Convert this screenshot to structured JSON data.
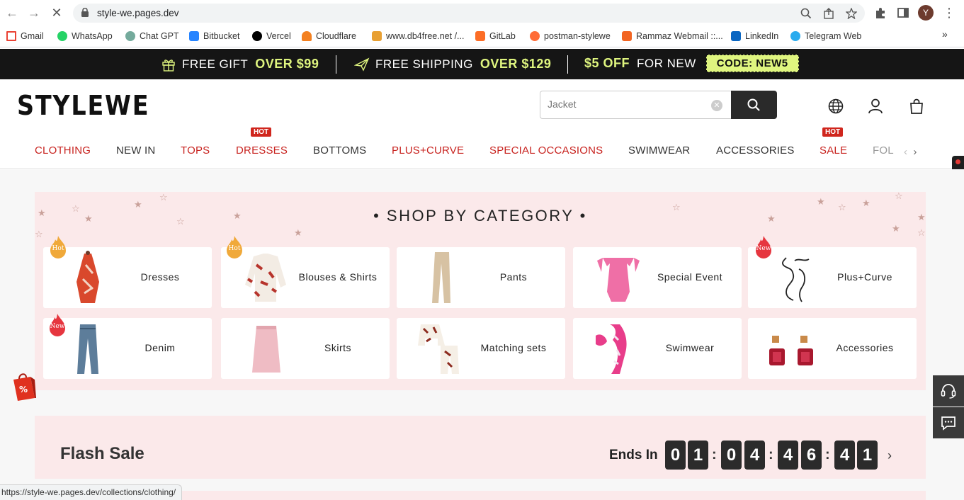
{
  "browser": {
    "url": "style-we.pages.dev",
    "status_url": "https://style-we.pages.dev/collections/clothing/",
    "avatar_letter": "Y",
    "bookmarks": [
      "Gmail",
      "WhatsApp",
      "Chat GPT",
      "Bitbucket",
      "Vercel",
      "Cloudflare",
      "www.db4free.net /...",
      "GitLab",
      "postman-stylewe",
      "Rammaz Webmail ::...",
      "LinkedIn",
      "Telegram Web"
    ],
    "more": "»"
  },
  "promo": {
    "gift_text": "FREE GIFT",
    "gift_highlight": "OVER $99",
    "shipping_text": "FREE SHIPPING",
    "shipping_highlight": "OVER $129",
    "off_highlight": "$5 OFF",
    "off_text": "FOR NEW",
    "code": "CODE: NEW5"
  },
  "header": {
    "logo": "STYLEWE",
    "search_placeholder": "Jacket"
  },
  "nav": {
    "items": [
      "CLOTHING",
      "NEW IN",
      "TOPS",
      "DRESSES",
      "BOTTOMS",
      "PLUS+CURVE",
      "SPECIAL OCCASIONS",
      "SWIMWEAR",
      "ACCESSORIES",
      "SALE",
      "FOL"
    ],
    "hot_label": "HOT"
  },
  "screenrec": "screenrec",
  "shop_by_category": {
    "title": "• SHOP BY CATEGORY •",
    "cards": [
      {
        "label": "Dresses",
        "badge": "Hot"
      },
      {
        "label": "Blouses & Shirts",
        "badge": "Hot"
      },
      {
        "label": "Pants",
        "badge": ""
      },
      {
        "label": "Special Event",
        "badge": ""
      },
      {
        "label": "Plus+Curve",
        "badge": "New"
      },
      {
        "label": "Denim",
        "badge": "New"
      },
      {
        "label": "Skirts",
        "badge": ""
      },
      {
        "label": "Matching sets",
        "badge": ""
      },
      {
        "label": "Swimwear",
        "badge": ""
      },
      {
        "label": "Accessories",
        "badge": ""
      }
    ]
  },
  "flash_sale": {
    "title": "Flash Sale",
    "ends_in": "Ends In",
    "digits": [
      "0",
      "1",
      "0",
      "4",
      "4",
      "6",
      "4",
      "1"
    ],
    "colon": ":",
    "arrow": "›"
  },
  "colors": {
    "accent_red": "#c8231f",
    "promo_green": "#dff57f",
    "panel_pink": "#fbe9ea"
  }
}
